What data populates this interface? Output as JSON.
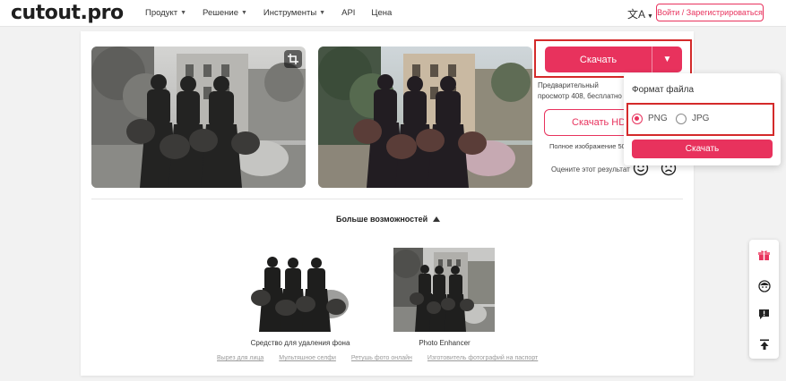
{
  "header": {
    "logo": "cutout.pro",
    "nav": [
      {
        "label": "Продукт",
        "has_dropdown": true
      },
      {
        "label": "Решение",
        "has_dropdown": true
      },
      {
        "label": "Инструменты",
        "has_dropdown": true
      },
      {
        "label": "API",
        "has_dropdown": false
      },
      {
        "label": "Цена",
        "has_dropdown": false
      }
    ],
    "lang_icon": "translate-icon",
    "login_label": "Войти / Зарегистрироваться"
  },
  "result": {
    "download_label": "Скачать",
    "preview_text": "Предварительный просмотр 408, бесплатно",
    "download_hd_label": "Скачать HD",
    "full_image_text": "Полное изображение 501",
    "rate_text": "Оцените этот результат"
  },
  "more": {
    "label": "Больше возможностей",
    "tools": [
      {
        "label": "Средство для удаления фона"
      },
      {
        "label": "Photo Enhancer"
      }
    ],
    "links": [
      "Вырез для лица",
      "Мультяшное селфи",
      "Ретушь фото онлайн",
      "Изготовитель фотографий на паспорт"
    ]
  },
  "format_popup": {
    "title": "Формат файла",
    "options": [
      "PNG",
      "JPG"
    ],
    "selected": "PNG",
    "download_label": "Скачать"
  },
  "side_toolbar": [
    "gift-icon",
    "face-icon",
    "feedback-icon",
    "back-to-top-icon"
  ],
  "colors": {
    "accent": "#e8325d",
    "highlight_frame": "#d42a2a"
  }
}
